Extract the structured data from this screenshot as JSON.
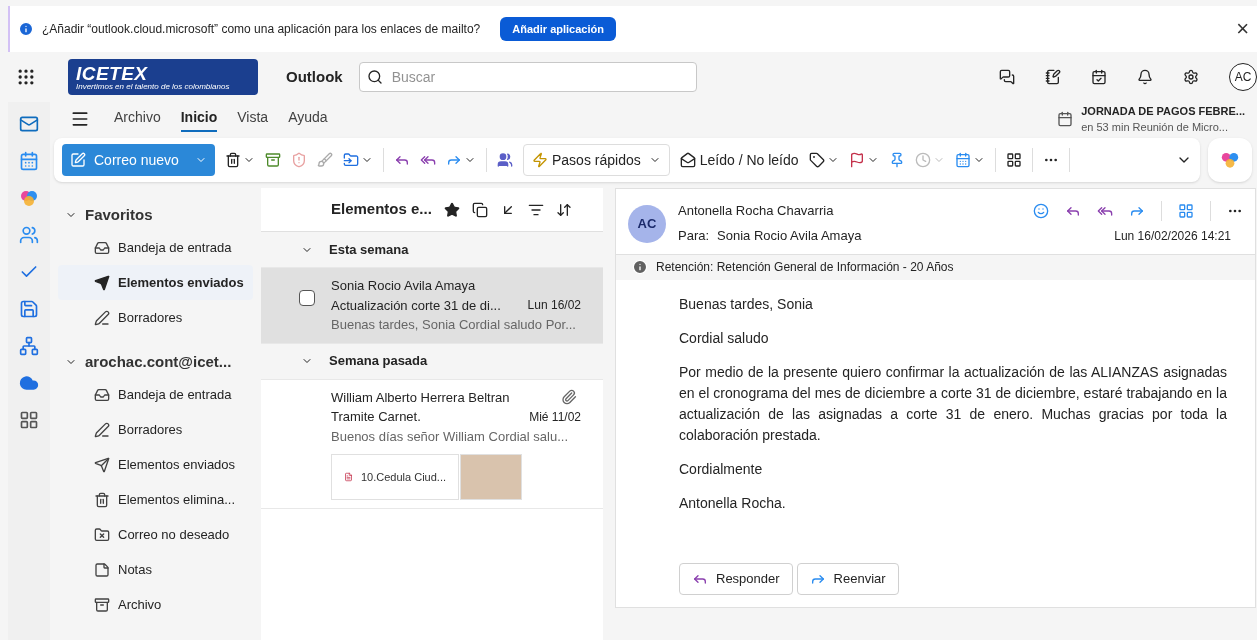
{
  "banner": {
    "message": "¿Añadir “outlook.cloud.microsoft” como una aplicación para los enlaces de mailto?",
    "button": "Añadir aplicación",
    "close": "×"
  },
  "topbar": {
    "logo_text": "ICETEX",
    "logo_tagline": "Invertimos en el talento de los colombianos",
    "app_name": "Outlook",
    "search": {
      "placeholder": "Buscar"
    },
    "avatar": "AC"
  },
  "ribbon": {
    "tabs": [
      {
        "label": "Archivo",
        "selected": false
      },
      {
        "label": "Inicio",
        "selected": true
      },
      {
        "label": "Vista",
        "selected": false
      },
      {
        "label": "Ayuda",
        "selected": false
      }
    ],
    "new_mail": "Correo nuevo",
    "quick_steps": "Pasos rápidos",
    "read_unread": "Leído / No leído"
  },
  "reminder": {
    "title": "JORNADA DE PAGOS FEBRE...",
    "subtitle": "en 53 min Reunión de Micro..."
  },
  "folders": [
    {
      "title": "Favoritos",
      "expanded": true,
      "items": [
        {
          "kind": "inbox",
          "label": "Bandeja de entrada",
          "selected": false
        },
        {
          "kind": "sent",
          "label": "Elementos enviados",
          "selected": true
        },
        {
          "kind": "drafts",
          "label": "Borradores",
          "selected": false
        }
      ]
    },
    {
      "title": "arochac.cont@icet...",
      "expanded": true,
      "items": [
        {
          "kind": "inbox",
          "label": "Bandeja de entrada",
          "selected": false
        },
        {
          "kind": "drafts",
          "label": "Borradores",
          "selected": false
        },
        {
          "kind": "sent",
          "label": "Elementos enviados",
          "selected": false
        },
        {
          "kind": "trash",
          "label": "Elementos elimina...",
          "selected": false
        },
        {
          "kind": "junk",
          "label": "Correo no deseado",
          "selected": false
        },
        {
          "kind": "notes",
          "label": "Notas",
          "selected": false
        },
        {
          "kind": "archive",
          "label": "Archivo",
          "selected": false
        }
      ]
    }
  ],
  "message_list": {
    "title": "Elementos e...",
    "groups": [
      {
        "title": "Esta semana",
        "expanded": true,
        "messages": [
          {
            "sender": "Sonia Rocio Avila Amaya",
            "subject": "Actualización corte 31 de di...",
            "date": "Lun 16/02",
            "preview": "Buenas tardes, Sonia Cordial saludo Por...",
            "selected": true,
            "attachment": false
          }
        ]
      },
      {
        "title": "Semana pasada",
        "expanded": true,
        "messages": [
          {
            "sender": "William Alberto Herrera Beltran",
            "subject": "Tramite Carnet.",
            "date": "Mié 11/02",
            "preview": "Buenos días señor William Cordial salu...",
            "selected": false,
            "attachment": true,
            "file": "10.Cedula Ciud..."
          }
        ]
      }
    ]
  },
  "reading": {
    "avatar": "AC",
    "from": "Antonella Rocha Chavarria",
    "to_label": "Para:",
    "to": "Sonia Rocio Avila Amaya",
    "date": "Lun 16/02/2026 14:21",
    "retention": "Retención: Retención General de Información - 20 Años",
    "body": [
      "Buenas tardes, Sonia",
      "Cordial saludo",
      "Por medio de la presente quiero confirmar la actualización de las ALIANZAS asignadas en el cronograma del mes de diciembre a corte 31 de diciembre, estaré trabajando en la actualización de las asignadas a corte 31 de enero. Muchas gracias por toda la colaboración prestada.",
      "Cordialmente",
      "Antonella Rocha."
    ],
    "reply": "Responder",
    "forward": "Reenviar"
  }
}
